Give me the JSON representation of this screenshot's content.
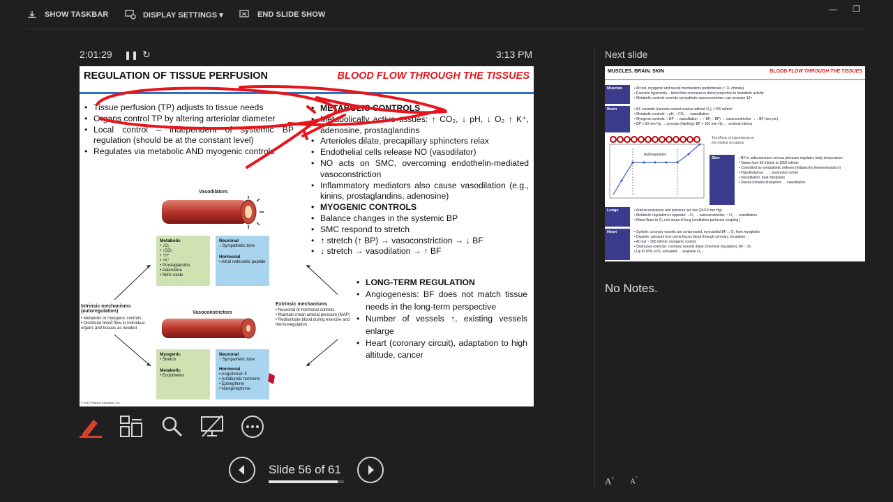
{
  "toolbar": {
    "show_taskbar": "SHOW TASKBAR",
    "display_settings": "DISPLAY SETTINGS ▾",
    "end_slide_show": "END SLIDE SHOW"
  },
  "presenter": {
    "timer": "2:01:29",
    "clock": "3:13 PM",
    "slide_counter": "Slide 56 of 61",
    "progress": 0.918,
    "next_slide_label": "Next slide",
    "notes": "No Notes."
  },
  "slide": {
    "title": "REGULATION OF TISSUE PERFUSION",
    "right_title": "BLOOD FLOW THROUGH THE TISSUES",
    "left_list": [
      "Tissue perfusion (TP) adjusts to tissue needs",
      "Organs control TP by altering arteriolar diameter",
      "Local control – independent of systemic BP regulation (should be at the constant level)",
      "Regulates via metabolic AND myogenic controls"
    ],
    "right_list": [
      {
        "text": "METABOLIC CONTROLS",
        "head": true
      },
      {
        "text": "Metabolically active tissues: ↑ CO₂, ↓ pH, ↓ O₂ ↑ K⁺, adenosine, prostaglandins",
        "head": false
      },
      {
        "text": "Arterioles dilate, precapillary sphincters relax",
        "head": false
      },
      {
        "text": "Endothelial cells release NO (vasodilator)",
        "head": false
      },
      {
        "text": "NO acts on SMC, overcoming endothelin-mediated vasoconstriction",
        "head": false
      },
      {
        "text": "Inflammatory mediators also cause vasodilation (e.g., kinins, prostaglandins, adenosine)",
        "head": false
      },
      {
        "text": "MYOGENIC CONTROLS",
        "head": true
      },
      {
        "text": "Balance changes in the systemic BP",
        "head": false
      },
      {
        "text": "SMC respond to stretch",
        "head": false
      },
      {
        "text": "↑ stretch (↑ BP) → vasoconstriction → ↓ BF",
        "head": false
      },
      {
        "text": "↓ stretch → vasodilation → ↑ BF",
        "head": false
      }
    ],
    "long_term": [
      {
        "text": "LONG-TERM REGULATION",
        "head": true
      },
      {
        "text": "Angiogenesis: BF does not match tissue needs in the long-term perspective",
        "head": false
      },
      {
        "text": "Number of vessels ↑, existing vessels enlarge",
        "head": false
      },
      {
        "text": "Heart (coronary circuit), adaptation to high altitude, cancer",
        "head": false
      }
    ],
    "figure": {
      "vasodilators": "Vasodilators",
      "vasoconstrictors": "Vasoconstrictors",
      "metabolic_title": "Metabolic",
      "metabolic_items": "• ↓O₂\n• ↑CO₂\n• ↑H⁺\n• ↑K⁺\n• Prostaglandins\n• Adenosine\n• Nitric oxide",
      "neuronal_title": "Neuronal",
      "neuronal_items": "↓ Sympathetic tone",
      "hormonal_title": "Hormonal",
      "hormonal_items": "• Atrial natriuretic peptide",
      "myogenic_title": "Myogenic",
      "myogenic_items": "• Stretch",
      "metabolic2_title": "Metabolic",
      "metabolic2_items": "• Endothelins",
      "neuronal2_title": "Neuronal",
      "neuronal2_items": "↑ Sympathetic tone",
      "hormonal2_title": "Hormonal",
      "hormonal2_items": "• Angiotensin II\n• Antidiuretic hormone\n• Epinephrine\n• Norepinephrine",
      "intrinsic_title": "Intrinsic mechanisms (autoregulation)",
      "intrinsic_text": "• Metabolic or myogenic controls\n• Distribute blood flow to individual organs and tissues as needed",
      "extrinsic_title": "Extrinsic mechanisms",
      "extrinsic_text": "• Neuronal or hormonal controls\n• Maintain mean arterial pressure (MAP)\n• Redistribute blood during exercise and thermoregulation",
      "copyright": "© 2013 Pearson Education, Inc."
    }
  },
  "next_slide": {
    "title": "MUSCLES. BRAIN. SKIN",
    "right_title": "BLOOD FLOW THROUGH THE TISSUES",
    "sections": [
      {
        "name": "Muscles",
        "items": [
          "At rest, myogenic and neural mechanisms predominate (~ 1L /minute)",
          "Exercise hyperemia – blood flow increases in direct proportion to metabolic activity",
          "Metabolic controls override sympathetic vasoconstriction; can increase 10×"
        ]
      },
      {
        "name": "Brain",
        "items": [
          "BF constant (neurons cannot survive without O₂), ≈750 ml/min",
          "Metabolic controls: ↓ pH, ↑ CO₂ → vasodilation",
          "Myogenic controls: ↓ BP → vasodilation → ↑ BF; ↑ BP) → vasoconstriction → ↓ BF (see pic)",
          "BP < 60 mm Hg → syncope (fainting); BP > 160 mm Hg → cerebral edema"
        ]
      },
      {
        "name": "Skin",
        "items": [
          "BF to subcutaneous venous plexuses regulates body temperature",
          "Varies from 50 ml/min to 2500 ml/min",
          "Controlled by sympathetic reflexes (initiated by thermoreceptors)",
          "Hypothalamus → ↓ vasomotor center",
          "Vasodilation, heat dissipates",
          "Sweat contains bradykinin → vasodilation"
        ]
      },
      {
        "name": "Lungs",
        "items": [
          "Arterial resistance and pressure are low (24/10 mm Hg)",
          "Metabolic regulation is opposite: ↓ O₂ → vasoconstriction; ↑ O₂ → vasodilation",
          "Blood flows to O₂-rich areas of lung (ventilation-perfusion coupling)"
        ]
      },
      {
        "name": "Heart",
        "items": [
          "Systole: coronary vessels are compressed, myocardial BF ↓, O₂ from myoglobin",
          "Diastole: pressure from aorta forces blood through coronary circulation",
          "At rest ~ 250 ml/min; myogenic control",
          "Strenuous exercise: coronary vessels dilate (chemical regulation), BF ↑ 3x",
          "Up to 65% of O₂ unloaded → available O₂ ↑"
        ]
      }
    ],
    "chart_caption": "The effects of hypertension on the cerebral circulation",
    "autoregulation_label": "Autoregulation"
  },
  "colors": {
    "accent_red": "#e8141b",
    "title_rule": "#2e6fc6",
    "section_blue": "#3b3b8e",
    "pen": "#d9402a"
  }
}
